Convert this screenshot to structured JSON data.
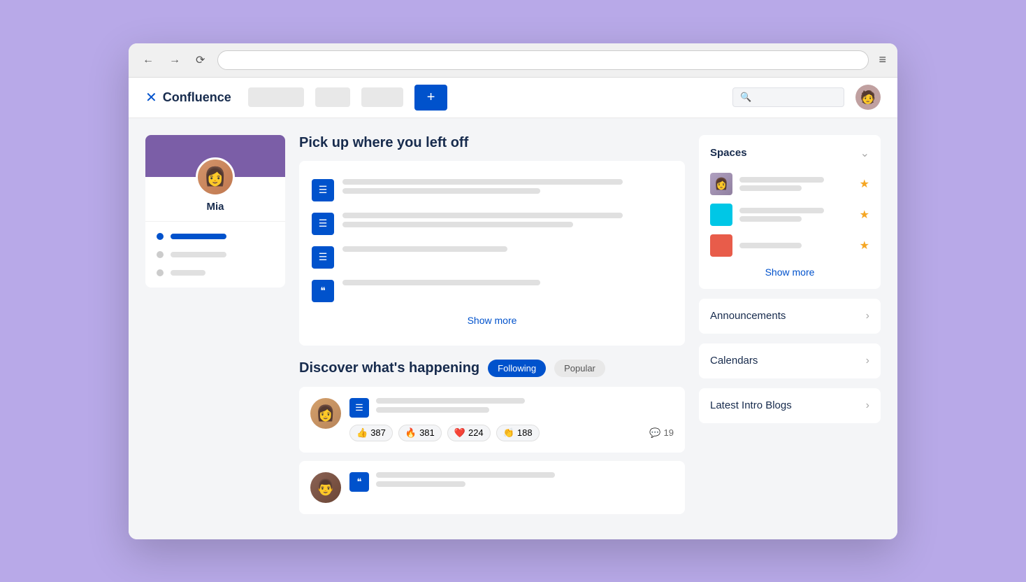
{
  "browser": {
    "url": "",
    "menu_icon": "≡"
  },
  "topnav": {
    "logo_text": "Confluence",
    "nav_items": [
      "",
      "",
      ""
    ],
    "create_label": "+",
    "search_placeholder": "",
    "avatar_alt": "User Avatar"
  },
  "profile": {
    "name": "Mia",
    "menu_items": [
      {
        "label": "",
        "active": true
      },
      {
        "label": "",
        "active": false
      },
      {
        "label": "",
        "active": false
      }
    ]
  },
  "recent": {
    "title": "Pick up where you left off",
    "show_more": "Show more"
  },
  "discover": {
    "title": "Discover what's happening",
    "tabs": [
      "Following",
      "Popular"
    ],
    "active_tab": "Following",
    "feed_items": [
      {
        "icon_type": "doc",
        "reactions": [
          {
            "emoji": "👍",
            "count": "387"
          },
          {
            "emoji": "🔥",
            "count": "381"
          },
          {
            "emoji": "❤️",
            "count": "224"
          },
          {
            "emoji": "👏",
            "count": "188"
          }
        ],
        "comments": "19"
      },
      {
        "icon_type": "quote",
        "reactions": []
      }
    ]
  },
  "spaces": {
    "title": "Spaces",
    "show_more": "Show more",
    "items": [
      {
        "color": "purple",
        "star": true
      },
      {
        "color": "cyan",
        "star": true
      },
      {
        "color": "red",
        "star": true
      }
    ]
  },
  "announcements": {
    "title": "Announcements"
  },
  "calendars": {
    "title": "Calendars"
  },
  "latest_intro_blogs": {
    "title": "Latest Intro Blogs"
  }
}
